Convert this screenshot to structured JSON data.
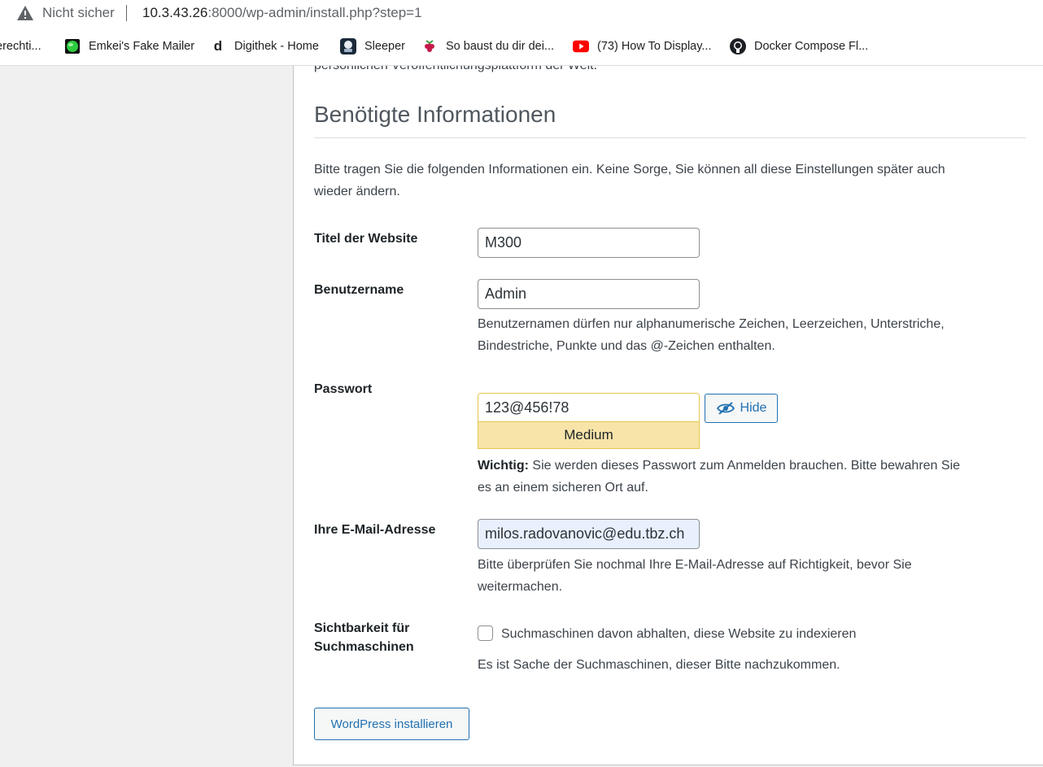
{
  "browser": {
    "security_label": "Nicht sicher",
    "url_host": "10.3.43.26",
    "url_rest": ":8000/wp-admin/install.php?step=1"
  },
  "bookmarks": [
    {
      "label": "erechti...",
      "icon": "none"
    },
    {
      "label": "Emkei's Fake Mailer",
      "icon": "green-globe-icon"
    },
    {
      "label": "Digithek - Home",
      "icon": "digithek-d-icon"
    },
    {
      "label": "Sleeper",
      "icon": "sleeper-icon"
    },
    {
      "label": "So baust du dir dei...",
      "icon": "raspberry-icon"
    },
    {
      "label": "(73) How To Display...",
      "icon": "youtube-icon"
    },
    {
      "label": "Docker Compose Fl...",
      "icon": "github-icon"
    }
  ],
  "page": {
    "intro_cut": "persönlichen Veröffentlichungsplattform der Welt.",
    "heading": "Benötigte Informationen",
    "instructions": "Bitte tragen Sie die folgenden Informationen ein. Keine Sorge, Sie können all diese Einstellungen später auch wieder ändern.",
    "instructions_line1": "Bitte tragen Sie die folgenden Informationen ein. Keine Sorge, Sie können all diese Einstellungen später auch",
    "instructions_line2": "wieder ändern."
  },
  "form": {
    "site_title": {
      "label": "Titel der Website",
      "value": "M300"
    },
    "username": {
      "label": "Benutzername",
      "value": "Admin",
      "hint_line1": "Benutzernamen dürfen nur alphanumerische Zeichen, Leerzeichen, Unterstriche,",
      "hint_line2": "Bindestriche, Punkte und das @-Zeichen enthalten."
    },
    "password": {
      "label": "Passwort",
      "value": "123@456!78",
      "hide_label": "Hide",
      "strength": "Medium",
      "important_bold": "Wichtig:",
      "important_line1": " Sie werden dieses Passwort zum Anmelden brauchen. Bitte bewahren Sie",
      "important_line2": "es an einem sicheren Ort auf."
    },
    "email": {
      "label": "Ihre E-Mail-Adresse",
      "value": "milos.radovanovic@edu.tbz.ch",
      "hint_line1": "Bitte überprüfen Sie nochmal Ihre E-Mail-Adresse auf Richtigkeit, bevor Sie",
      "hint_line2": "weitermachen."
    },
    "visibility": {
      "label_line1": "Sichtbarkeit für",
      "label_line2": "Suchmaschinen",
      "checkbox_label": "Suchmaschinen davon abhalten, diese Website zu indexieren",
      "checked": false,
      "note": "Es ist Sache der Suchmaschinen, dieser Bitte nachzukommen."
    },
    "submit_label": "WordPress installieren"
  },
  "colors": {
    "accent": "#2271b1",
    "strength_medium_bg": "#f8e4a9",
    "strength_medium_border": "#e6c64c",
    "autofill_bg": "#e8f0fe"
  }
}
